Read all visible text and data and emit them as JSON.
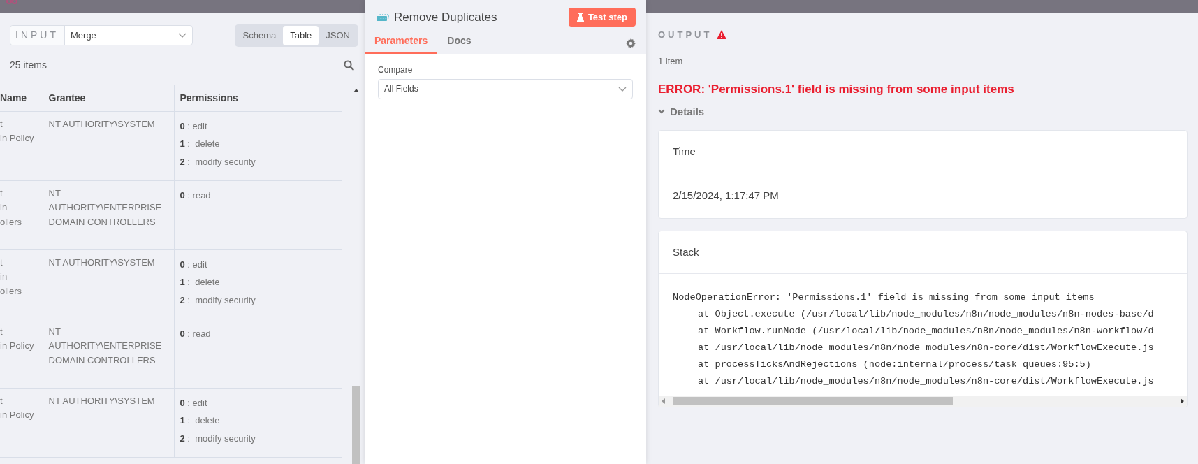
{
  "input_panel": {
    "label": "INPUT",
    "source": "Merge",
    "view_modes": [
      {
        "label": "Schema",
        "selected": false
      },
      {
        "label": "Table",
        "selected": true
      },
      {
        "label": "JSON",
        "selected": false
      }
    ],
    "item_count": "25 items",
    "table": {
      "columns": [
        "Name",
        "Grantee",
        "Permissions"
      ],
      "rows": [
        {
          "name": "t\nin Policy",
          "grantee": "NT AUTHORITY\\SYSTEM",
          "permissions": [
            "**0** : edit",
            "**1** :  delete",
            "**2** :  modify security"
          ]
        },
        {
          "name": "t\nin\nollers",
          "grantee": "NT AUTHORITY\\ENTERPRISE DOMAIN CONTROLLERS",
          "permissions": [
            "**0** : read"
          ]
        },
        {
          "name": "t\nin\nollers",
          "grantee": "NT AUTHORITY\\SYSTEM",
          "permissions": [
            "**0** : edit",
            "**1** :  delete",
            "**2** :  modify security"
          ]
        },
        {
          "name": "t\nin Policy",
          "grantee": "NT AUTHORITY\\ENTERPRISE DOMAIN CONTROLLERS",
          "permissions": [
            "**0** : read"
          ]
        },
        {
          "name": "t\nin Policy",
          "grantee": "NT AUTHORITY\\SYSTEM",
          "permissions": [
            "**0** : edit",
            "**1** :  delete",
            "**2** :  modify security"
          ]
        }
      ]
    }
  },
  "node": {
    "title": "Remove Duplicates",
    "test_button": "Test step",
    "tabs": [
      {
        "label": "Parameters",
        "selected": true
      },
      {
        "label": "Docs",
        "selected": false
      }
    ],
    "parameters": [
      {
        "label": "Compare",
        "value": "All Fields"
      }
    ]
  },
  "output_panel": {
    "label": "OUTPUT",
    "has_error": true,
    "item_count": "1 item",
    "error": "ERROR: 'Permissions.1' field is missing from some input items",
    "details": {
      "label": "Details",
      "expanded": true
    },
    "cards": [
      {
        "kind": "text",
        "title": "Time",
        "body": "2/15/2024, 1:17:47 PM"
      },
      {
        "kind": "stack",
        "title": "Stack",
        "message": "NodeOperationError: 'Permissions.1' field is missing from some input items",
        "frames": [
          "at Object.execute (/usr/local/lib/node_modules/n8n/node_modules/n8n-nodes-base/d",
          "at Workflow.runNode (/usr/local/lib/node_modules/n8n/node_modules/n8n-workflow/d",
          "at /usr/local/lib/node_modules/n8n/node_modules/n8n-core/dist/WorkflowExecute.js",
          "at processTicksAndRejections (node:internal/process/task_queues:95:5)",
          "at /usr/local/lib/node_modules/n8n/node_modules/n8n-core/dist/WorkflowExecute.js"
        ]
      }
    ]
  }
}
